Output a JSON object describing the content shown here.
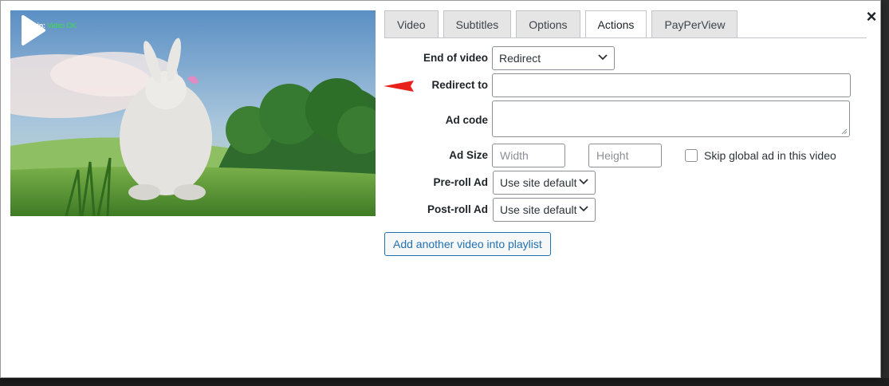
{
  "window": {
    "close_label": "×"
  },
  "video": {
    "admin_label": "Admin:",
    "admin_status": "Video OK"
  },
  "tabs": [
    {
      "label": "Video",
      "active": false
    },
    {
      "label": "Subtitles",
      "active": false
    },
    {
      "label": "Options",
      "active": false
    },
    {
      "label": "Actions",
      "active": true
    },
    {
      "label": "PayPerView",
      "active": false
    }
  ],
  "form": {
    "end_of_video": {
      "label": "End of video",
      "value": "Redirect"
    },
    "redirect_to": {
      "label": "Redirect to",
      "value": ""
    },
    "ad_code": {
      "label": "Ad code",
      "value": ""
    },
    "ad_size": {
      "label": "Ad Size",
      "width_placeholder": "Width",
      "height_placeholder": "Height",
      "skip_label": "Skip global ad in this video",
      "skip_checked": false
    },
    "pre_roll": {
      "label": "Pre-roll Ad",
      "value": "Use site default"
    },
    "post_roll": {
      "label": "Post-roll Ad",
      "value": "Use site default"
    }
  },
  "buttons": {
    "add_video": "Add another video into playlist"
  },
  "colors": {
    "accent": "#2271b1",
    "arrow": "#e8211b",
    "status_ok": "#3ddc4a"
  },
  "icons": [
    "close-icon",
    "play-icon",
    "chevron-down-icon",
    "red-arrow-icon"
  ]
}
